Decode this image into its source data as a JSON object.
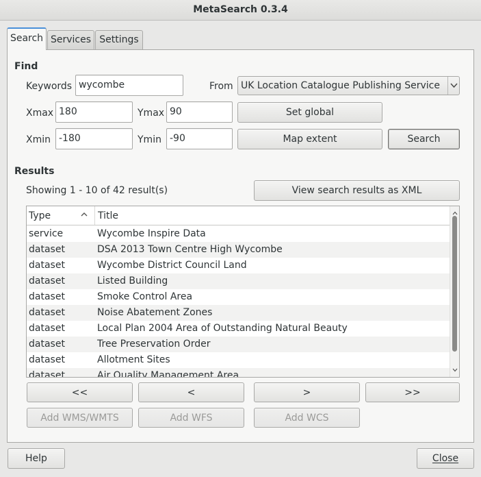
{
  "window": {
    "title": "MetaSearch 0.3.4"
  },
  "tabs": [
    "Search",
    "Services",
    "Settings"
  ],
  "find": {
    "heading": "Find",
    "keywords_label": "Keywords",
    "keywords_value": "wycombe",
    "from_label": "From",
    "from_value": "UK Location Catalogue Publishing Service",
    "xmax_label": "Xmax",
    "xmax_value": "180",
    "ymax_label": "Ymax",
    "ymax_value": "90",
    "xmin_label": "Xmin",
    "xmin_value": "-180",
    "ymin_label": "Ymin",
    "ymin_value": "-90",
    "set_global_label": "Set global",
    "map_extent_label": "Map extent",
    "search_label": "Search"
  },
  "results": {
    "heading": "Results",
    "showing": "Showing 1 - 10 of 42 result(s)",
    "view_xml_label": "View search results as XML",
    "col_type": "Type",
    "col_title": "Title",
    "rows": [
      {
        "type": "service",
        "title": "Wycombe Inspire Data"
      },
      {
        "type": "dataset",
        "title": "DSA 2013 Town Centre High Wycombe"
      },
      {
        "type": "dataset",
        "title": "Wycombe District Council Land"
      },
      {
        "type": "dataset",
        "title": "Listed Building"
      },
      {
        "type": "dataset",
        "title": "Smoke Control Area"
      },
      {
        "type": "dataset",
        "title": "Noise Abatement Zones"
      },
      {
        "type": "dataset",
        "title": "Local Plan 2004 Area of Outstanding Natural Beauty"
      },
      {
        "type": "dataset",
        "title": "Tree Preservation Order"
      },
      {
        "type": "dataset",
        "title": "Allotment Sites"
      },
      {
        "type": "dataset",
        "title": "Air Quality Management Area"
      }
    ],
    "nav": {
      "first": "<<",
      "prev": "<",
      "next": ">",
      "last": ">>"
    },
    "add_wms": "Add WMS/WMTS",
    "add_wfs": "Add WFS",
    "add_wcs": "Add WCS"
  },
  "footer": {
    "help": "Help",
    "close": "Close"
  },
  "icons": {
    "sort": "sort-ascending-icon",
    "dropdown": "chevron-down-icon"
  }
}
